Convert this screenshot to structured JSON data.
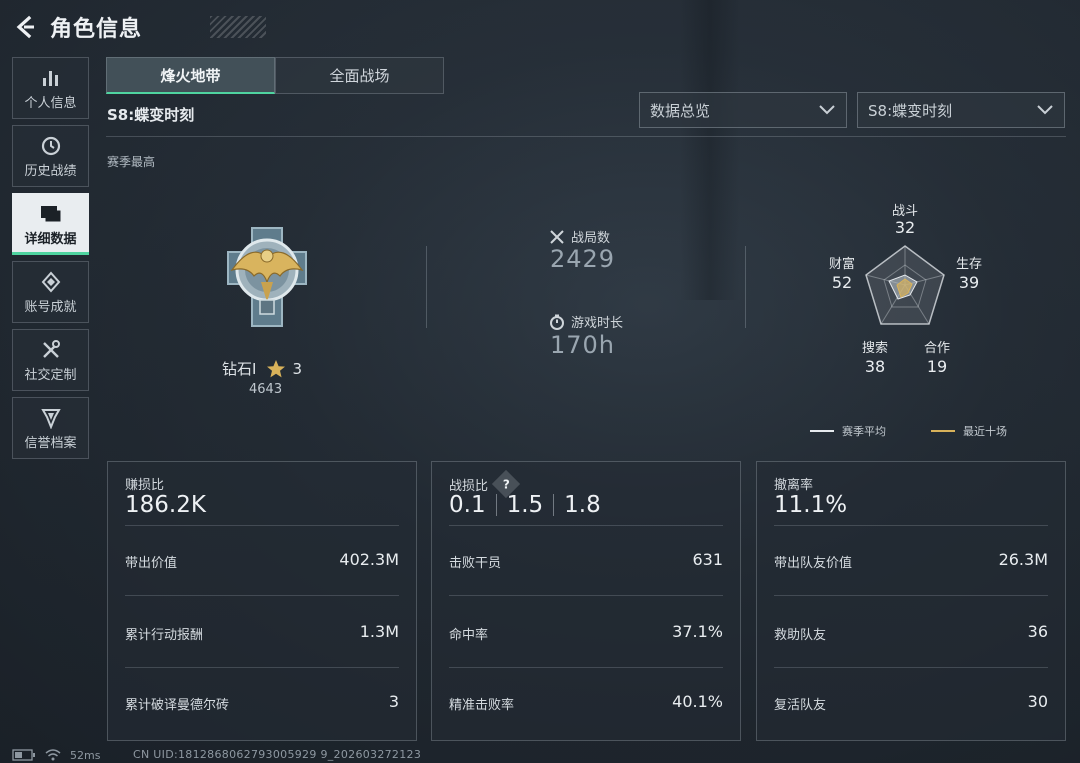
{
  "header": {
    "title": "角色信息"
  },
  "sidebar": {
    "items": [
      {
        "label": "个人信息",
        "icon": "bar-chart-icon"
      },
      {
        "label": "历史战绩",
        "icon": "clock-icon"
      },
      {
        "label": "详细数据",
        "icon": "folder-icon",
        "active": true
      },
      {
        "label": "账号成就",
        "icon": "achievement-icon"
      },
      {
        "label": "社交定制",
        "icon": "tools-icon"
      },
      {
        "label": "信誉档案",
        "icon": "shield-badge-icon"
      }
    ]
  },
  "tabs": [
    {
      "label": "烽火地带",
      "active": true
    },
    {
      "label": "全面战场",
      "active": false
    }
  ],
  "season": {
    "title": "S8:蝶变时刻",
    "best_label": "赛季最高"
  },
  "filters": {
    "overview": "数据总览",
    "season": "S8:蝶变时刻"
  },
  "rank": {
    "name": "钻石I",
    "stars": "3",
    "points": "4643"
  },
  "stats": {
    "matches_label": "战局数",
    "matches_value": "2429",
    "playtime_label": "游戏时长",
    "playtime_value": "170h"
  },
  "radar": {
    "axes": [
      {
        "label": "战斗",
        "value": "32"
      },
      {
        "label": "生存",
        "value": "39"
      },
      {
        "label": "合作",
        "value": "19"
      },
      {
        "label": "搜索",
        "value": "38"
      },
      {
        "label": "财富",
        "value": "52"
      }
    ],
    "legend_season": "赛季平均",
    "legend_recent": "最近十场"
  },
  "cards": {
    "profit": {
      "label": "赚损比",
      "value": "186.2K",
      "rows": [
        {
          "label": "带出价值",
          "value": "402.3M"
        },
        {
          "label": "累计行动报酬",
          "value": "1.3M"
        },
        {
          "label": "累计破译曼德尔砖",
          "value": "3"
        }
      ]
    },
    "kd": {
      "label": "战损比",
      "values": [
        "0.1",
        "1.5",
        "1.8"
      ],
      "rows": [
        {
          "label": "击败干员",
          "value": "631"
        },
        {
          "label": "命中率",
          "value": "37.1%"
        },
        {
          "label": "精准击败率",
          "value": "40.1%"
        }
      ]
    },
    "extract": {
      "label": "撤离率",
      "value": "11.1%",
      "rows": [
        {
          "label": "带出队友价值",
          "value": "26.3M"
        },
        {
          "label": "救助队友",
          "value": "36"
        },
        {
          "label": "复活队友",
          "value": "30"
        }
      ]
    }
  },
  "status": {
    "ping": "52ms",
    "uid": "CN UID:1812868062793005929 9_202603272123"
  },
  "colors": {
    "accent": "#4fd4a0",
    "gold": "#d8b25a"
  }
}
